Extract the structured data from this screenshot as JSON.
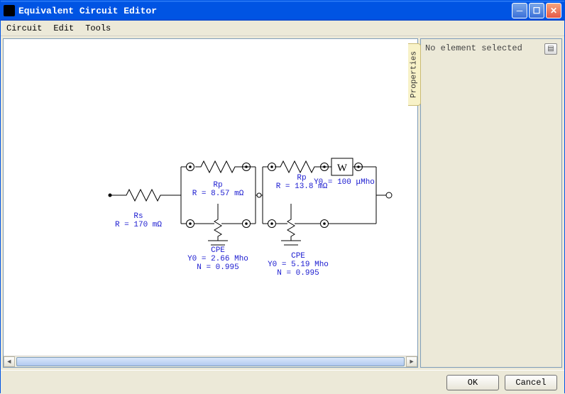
{
  "window": {
    "title": "Equivalent Circuit Editor"
  },
  "menubar": {
    "items": [
      "Circuit",
      "Edit",
      "Tools"
    ]
  },
  "properties_panel": {
    "tab_label": "Properties",
    "message": "No element selected"
  },
  "buttons": {
    "ok": "OK",
    "cancel": "Cancel"
  },
  "circuit": {
    "elements": [
      {
        "type": "resistor",
        "name": "Rs",
        "param_line": "R = 170 mΩ"
      },
      {
        "type": "parallel_block",
        "branches": [
          {
            "type": "resistor",
            "name": "Rp",
            "param_line": "R = 8.57 mΩ"
          },
          {
            "type": "cpe",
            "name": "CPE",
            "param_line1": "Y0 = 2.66 Mho",
            "param_line2": "N = 0.995"
          }
        ]
      },
      {
        "type": "parallel_block",
        "branches": [
          {
            "type": "series",
            "items": [
              {
                "type": "resistor",
                "name": "Rp",
                "param_line": "R = 13.8 mΩ"
              },
              {
                "type": "warburg",
                "name": "W",
                "param_line": "Y0 = 100 μMho"
              }
            ]
          },
          {
            "type": "cpe",
            "name": "CPE",
            "param_line1": "Y0 = 5.19 Mho",
            "param_line2": "N = 0.995"
          }
        ]
      }
    ]
  }
}
